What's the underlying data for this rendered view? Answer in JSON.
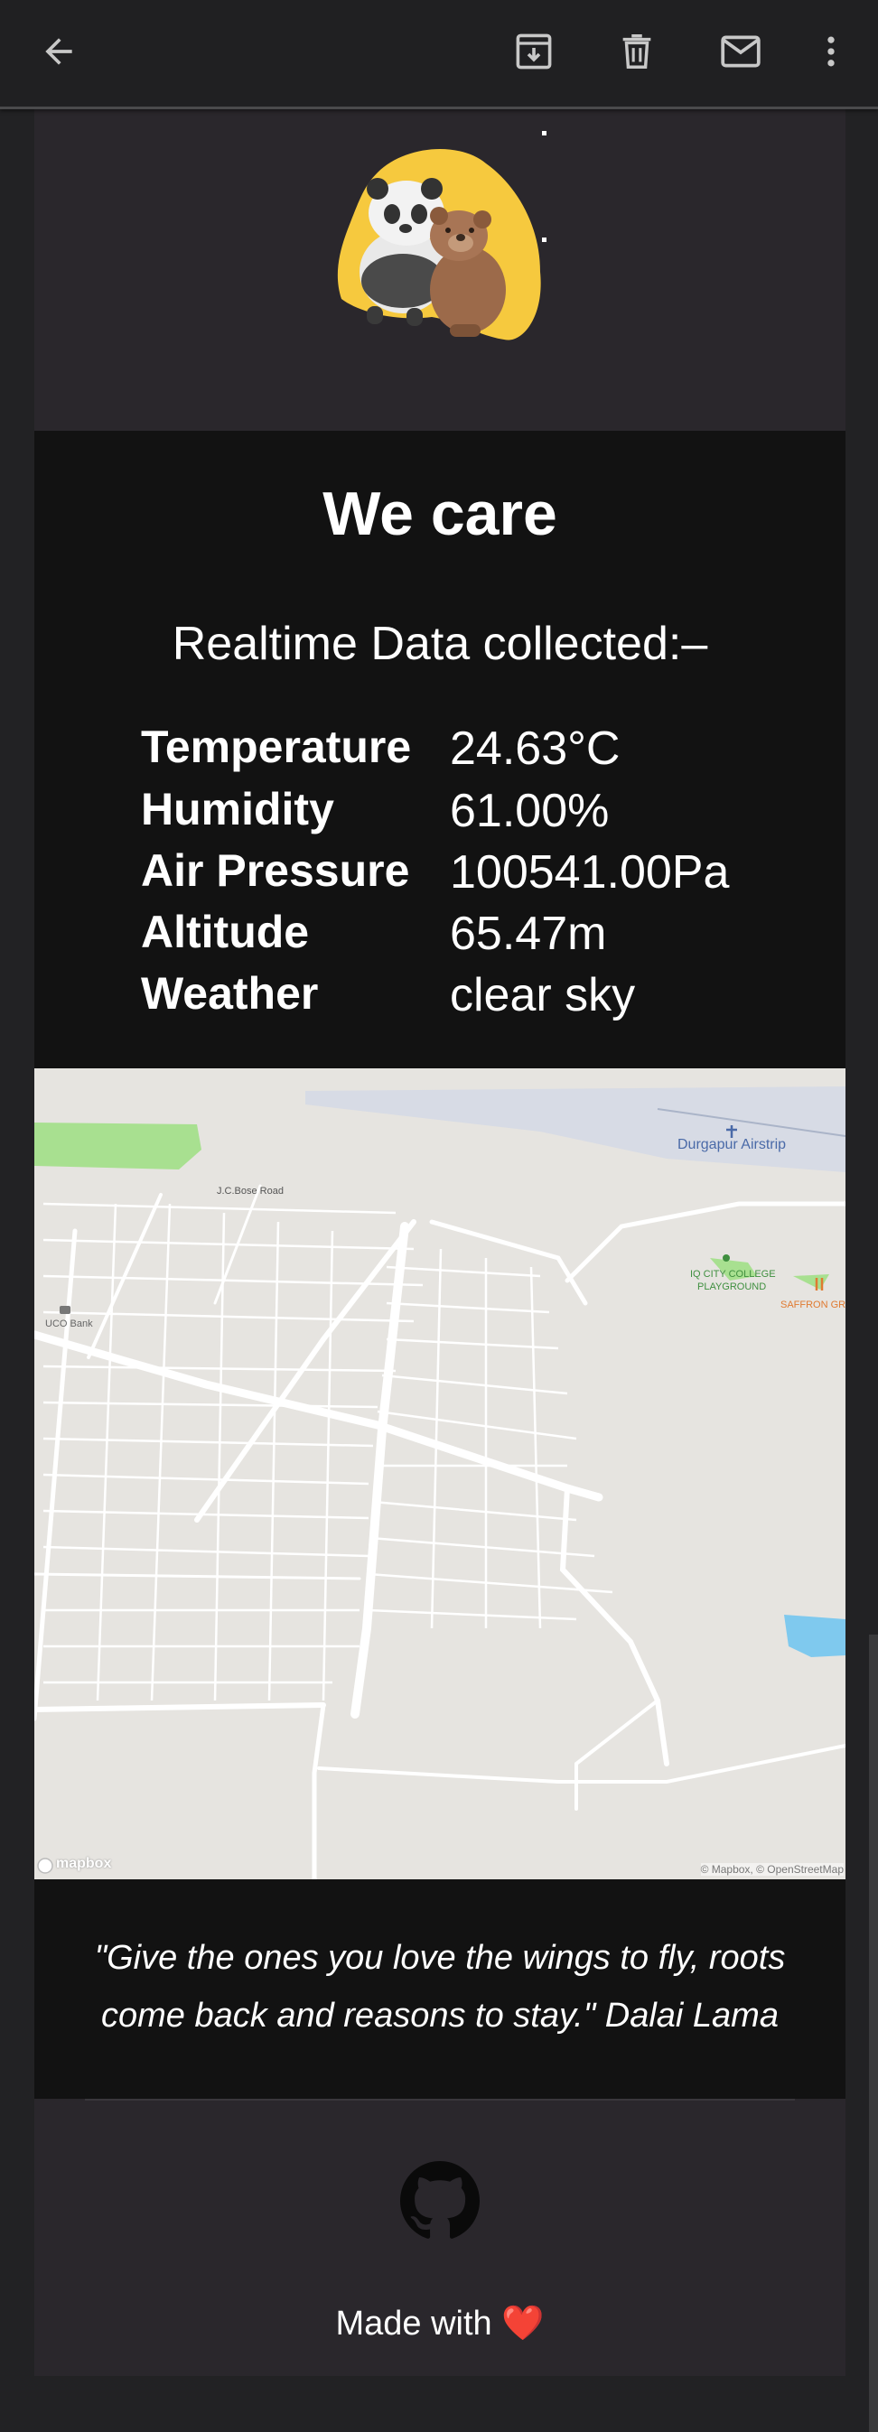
{
  "toolbar": {
    "back_icon": "arrow-left-icon",
    "archive_icon": "archive-icon",
    "delete_icon": "trash-icon",
    "mark_unread_icon": "mail-icon",
    "more_icon": "more-vert-icon"
  },
  "email": {
    "hero_image": "panda-and-bear-hug-illustration",
    "title": "We care",
    "subtitle": "Realtime Data collected:–",
    "readings": [
      {
        "label": "Temperature",
        "value": "24.63°C"
      },
      {
        "label": "Humidity",
        "value": "61.00%"
      },
      {
        "label": "Air Pressure",
        "value": "100541.00Pa"
      },
      {
        "label": "Altitude",
        "value": "65.47m"
      },
      {
        "label": "Weather",
        "value": "clear sky"
      }
    ],
    "map": {
      "labels": {
        "airport": "Durgapur Airstrip",
        "road": "J.C.Bose Road",
        "bank": "UCO Bank",
        "playground_line1": "IQ CITY COLLEGE",
        "playground_line2": "PLAYGROUND",
        "restaurant": "SAFFRON GRI",
        "logo": "mapbox",
        "attribution": "© Mapbox, © OpenStreetMap"
      }
    },
    "quote_line1": "\"Give the ones you love the wings to fly, roots",
    "quote_line2": "come back and reasons to stay.\" Dalai Lama",
    "footer": {
      "github_icon": "github-icon",
      "made_with": "Made with",
      "heart": "❤️"
    }
  },
  "colors": {
    "background": "#222224",
    "card_header": "#2a272c",
    "card_dark": "#121212",
    "text": "#ffffff",
    "heart": "#ff2a3a"
  }
}
